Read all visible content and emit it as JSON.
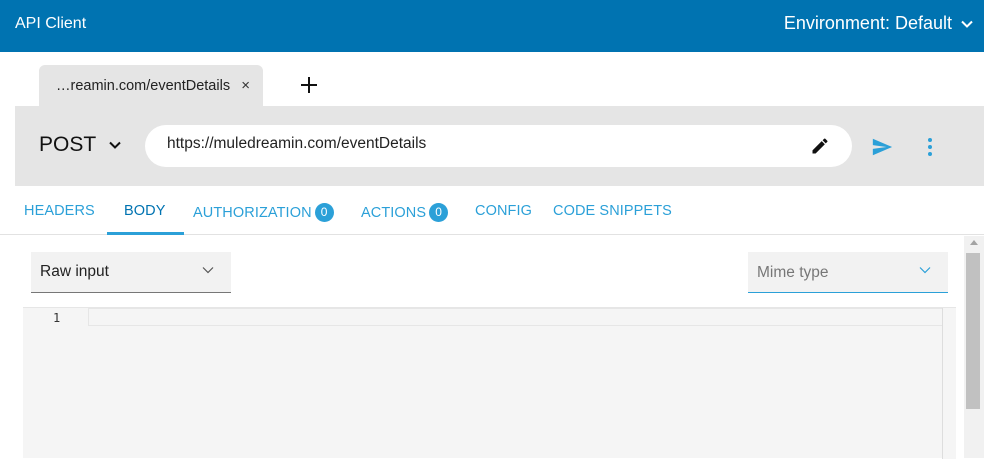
{
  "header": {
    "app_title": "API Client",
    "environment_label": "Environment: Default"
  },
  "request_tabs": [
    {
      "label": "…reamin.com/eventDetails",
      "close_glyph": "×"
    }
  ],
  "request": {
    "method": "POST",
    "url": "https://muledreamin.com/eventDetails"
  },
  "subtabs": [
    {
      "label": "HEADERS",
      "badge": null
    },
    {
      "label": "BODY",
      "badge": null,
      "active": true
    },
    {
      "label": "AUTHORIZATION",
      "badge": "0"
    },
    {
      "label": "ACTIONS",
      "badge": "0"
    },
    {
      "label": "CONFIG",
      "badge": null
    },
    {
      "label": "CODE SNIPPETS",
      "badge": null
    }
  ],
  "body": {
    "editor_mode": "Raw input",
    "mime_placeholder": "Mime type",
    "line_numbers": [
      "1"
    ]
  },
  "colors": {
    "header_bg": "#0073b1",
    "accent": "#2ba0d8",
    "bar_bg": "#e5e5e5"
  },
  "icons": {
    "env_dropdown": "chevron-down-icon",
    "method_dropdown": "chevron-down-icon",
    "add_tab": "plus-icon",
    "edit_url": "pencil-icon",
    "send": "send-icon",
    "more": "more-vertical-icon"
  }
}
